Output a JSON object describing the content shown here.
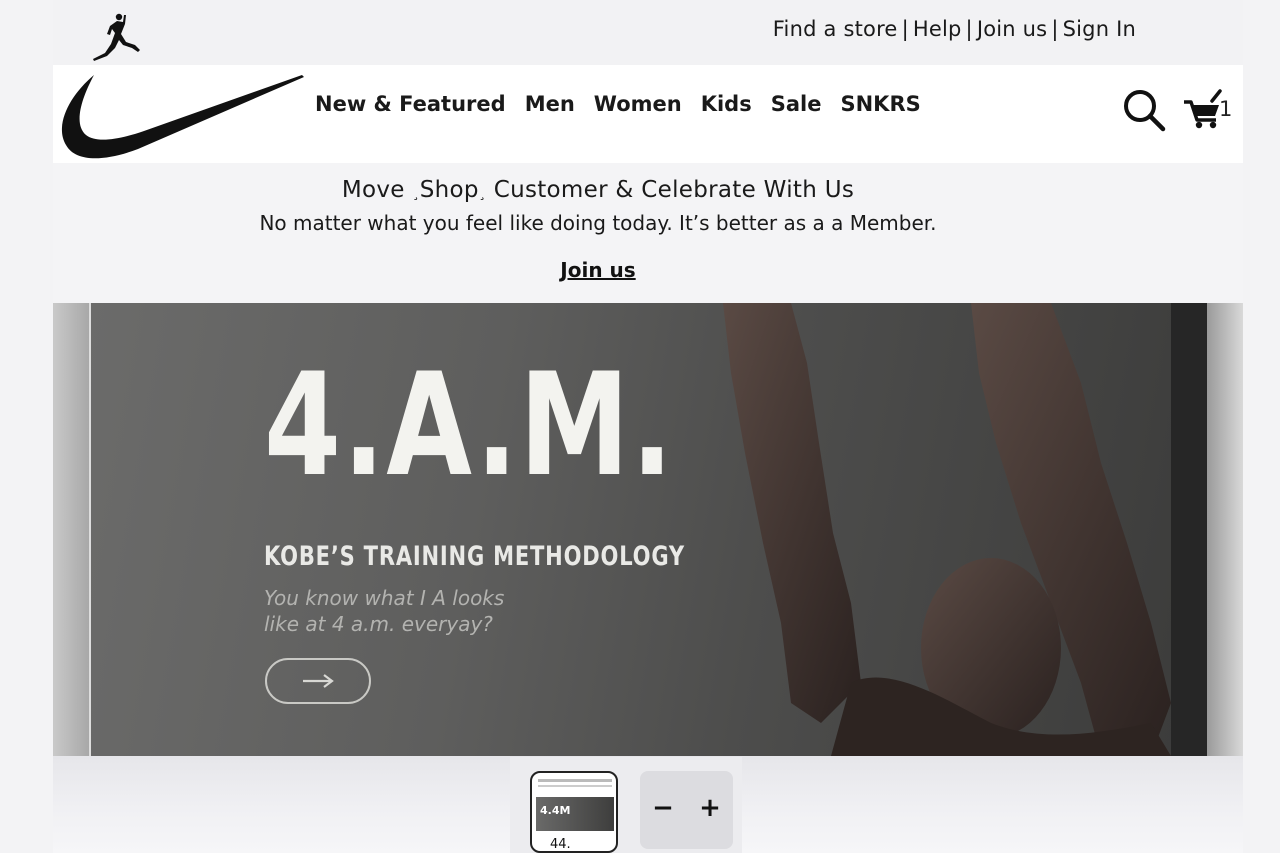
{
  "utility": {
    "links": [
      "Find a store",
      "Help",
      "Join us",
      "Sign In"
    ],
    "separator": "|"
  },
  "nav": {
    "items": [
      "New & Featured",
      "Men",
      "Women",
      "Kids",
      "Sale",
      "SNKRS"
    ],
    "cart_count": "1",
    "icons": [
      "jordan-jumpman-logo",
      "nike-swoosh-logo",
      "search-icon",
      "cart-icon"
    ]
  },
  "member": {
    "title_parts": [
      "Move",
      "Shop",
      "Customer & Celebrate With Us"
    ],
    "title_marks": [
      "¸",
      "¸"
    ],
    "subtitle": "No matter what you feel like doing today. It’s better as a a Member.",
    "join_label": "Join us"
  },
  "hero": {
    "headline": "4.A.M.",
    "subheadline": "KOBE’S TRAINING METHODOLOGY",
    "copy_line1": "You know what I A looks",
    "copy_line2": "like at 4 a.m. everyay?",
    "cta_icon": "arrow-right-icon"
  },
  "preview": {
    "thumb_text": "4.4M",
    "thumb_caption": "44.",
    "zoom_out": "−",
    "zoom_in": "+"
  },
  "colors": {
    "nav_bg": "#ffffff",
    "page_bg": "#f3f3f5",
    "hero_text": "#f3f3ef",
    "hero_dim_text": "#b3b3b0"
  }
}
